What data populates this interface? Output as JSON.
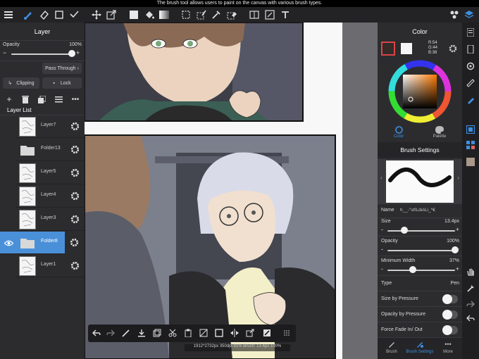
{
  "tooltip": "The brush tool allows users to paint on the canvas with various brush types.",
  "layer_panel": {
    "title": "Layer",
    "opacity_label": "Opacity",
    "opacity_value": "100%",
    "opacity_fraction": 1.0,
    "blend_mode": "Pass Through",
    "clipping_label": "Clipping",
    "lock_label": "Lock",
    "list_title": "Layer List",
    "layers": [
      {
        "name": "Layer7",
        "type": "layer",
        "selected": false
      },
      {
        "name": "Folder13",
        "type": "folder",
        "selected": false
      },
      {
        "name": "Layer5",
        "type": "layer",
        "selected": false
      },
      {
        "name": "Layer4",
        "type": "layer",
        "selected": false
      },
      {
        "name": "Layer3",
        "type": "layer",
        "selected": false
      },
      {
        "name": "Folder8",
        "type": "folder",
        "selected": true
      },
      {
        "name": "Layer1",
        "type": "layer",
        "selected": false
      }
    ]
  },
  "color_panel": {
    "title": "Color",
    "rgb_r": "R:54",
    "rgb_g": "G:44",
    "rgb_b": "B:38",
    "main_color": "#362c26",
    "tab_color": "Color",
    "tab_palette": "Palette"
  },
  "brush_settings": {
    "title": "Brush Settings",
    "name_label": "Name",
    "name_value": "h__-\"sťlLdu\\Li_*€",
    "size_label": "Size",
    "size_value": "13.4px",
    "size_fraction": 0.25,
    "opacity_label": "Opacity",
    "opacity_value": "100%",
    "opacity_fraction": 1.0,
    "min_width_label": "Minimum Width",
    "min_width_value": "37%",
    "min_width_fraction": 0.37,
    "type_label": "Type",
    "type_value": "Pen",
    "size_pressure_label": "Size by Pressure",
    "opacity_pressure_label": "Opacity by Pressure",
    "force_fade_label": "Force Fade In/ Out",
    "tab_brush": "Brush",
    "tab_brush_settings": "Brush Settings",
    "tab_more": "More"
  },
  "status": "1912*2732px 350dpi 81% Brush: 13.4px 100%",
  "colors": {
    "accent": "#3d8fe0",
    "panel_bg": "#2c2c2f",
    "selected_row": "#4a90d9"
  }
}
